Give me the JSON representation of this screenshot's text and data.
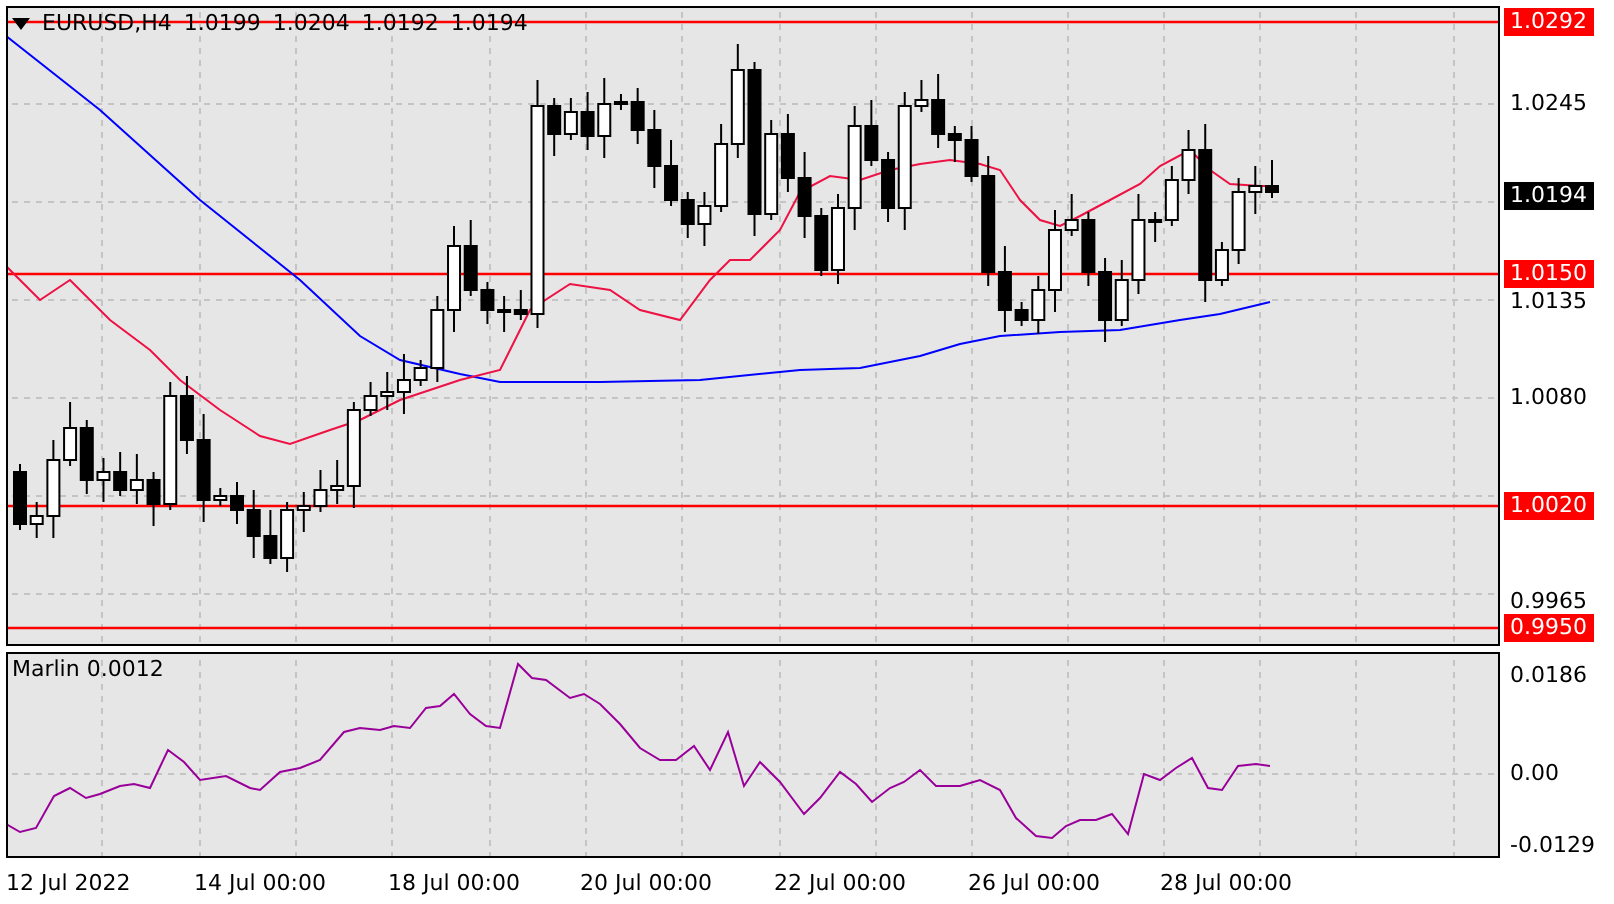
{
  "chart": {
    "symbol": "EURUSD,H4",
    "ohlc": [
      "1.0199",
      "1.0204",
      "1.0192",
      "1.0194"
    ]
  },
  "price_axis": [
    {
      "label": "1.0292",
      "kind": "level"
    },
    {
      "label": "1.0245",
      "kind": "tick"
    },
    {
      "label": "1.0194",
      "kind": "current"
    },
    {
      "label": "1.0150",
      "kind": "level"
    },
    {
      "label": "1.0135",
      "kind": "tick"
    },
    {
      "label": "1.0080",
      "kind": "tick"
    },
    {
      "label": "1.0020",
      "kind": "level"
    },
    {
      "label": "0.9965",
      "kind": "tick"
    },
    {
      "label": "0.9950",
      "kind": "level"
    }
  ],
  "indicator": {
    "label": "Marlin 0.0012",
    "axis": [
      "0.0186",
      "0.00",
      "-0.0129"
    ]
  },
  "time_axis": [
    "12 Jul 2022",
    "14 Jul 00:00",
    "18 Jul 00:00",
    "20 Jul 00:00",
    "22 Jul 00:00",
    "26 Jul 00:00",
    "28 Jul 00:00"
  ]
}
